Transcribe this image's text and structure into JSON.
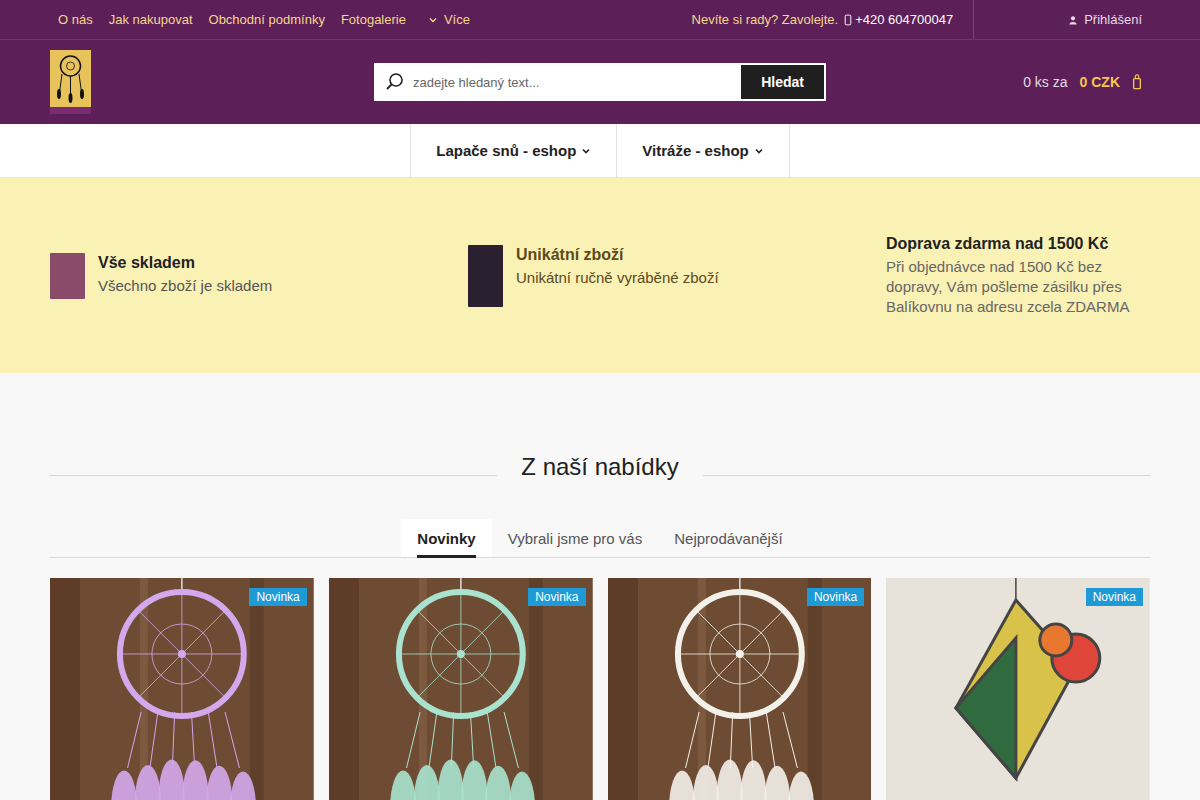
{
  "top_bar": {
    "links": [
      {
        "label": "O nás"
      },
      {
        "label": "Jak nakupovat"
      },
      {
        "label": "Obchodní podmínky"
      },
      {
        "label": "Fotogalerie"
      }
    ],
    "more": "Více",
    "help": "Nevíte si rady? Zavolejte.",
    "phone": "+420 604700047",
    "login": "Přihlášení"
  },
  "search": {
    "placeholder": "zadejte hledaný text...",
    "button": "Hledat"
  },
  "cart": {
    "count": "0 ks za",
    "total": "0 CZK"
  },
  "nav": [
    {
      "label": "Lapače snů - eshop"
    },
    {
      "label": "Vitráže - eshop"
    }
  ],
  "benefits": [
    {
      "kind": "image",
      "title": "Vše skladem",
      "text": "Všechno zboží je skladem",
      "color": "#8a4a6a"
    },
    {
      "kind": "image",
      "title": "Unikátní zboží",
      "text": "Unikátní ručně vyráběné zboží",
      "color": "#2a2030"
    },
    {
      "kind": "text",
      "title": "Doprava zdarma nad 1500 Kč",
      "text": "Při objednávce nad 1500 Kč bez dopravy, Vám pošleme zásilku přes Balíkovnu na adresu zcela ZDARMA",
      "color": "#000000"
    }
  ],
  "section": {
    "title": "Z naší nabídky"
  },
  "tabs": [
    {
      "label": "Novinky",
      "selected": true
    },
    {
      "label": "Vybrali jsme pro vás",
      "selected": false
    },
    {
      "label": "Nejprodávanější",
      "selected": false
    }
  ],
  "products": [
    {
      "kind": "dreamcatcher",
      "badge": "Novinka",
      "color": "#d4a8ec"
    },
    {
      "kind": "dreamcatcher",
      "badge": "Novinka",
      "color": "#a9e3cf"
    },
    {
      "kind": "dreamcatcher",
      "badge": "Novinka",
      "color": "#f3f1ea"
    },
    {
      "kind": "glass",
      "badge": "Novinka",
      "color": "#e0453a"
    }
  ]
}
